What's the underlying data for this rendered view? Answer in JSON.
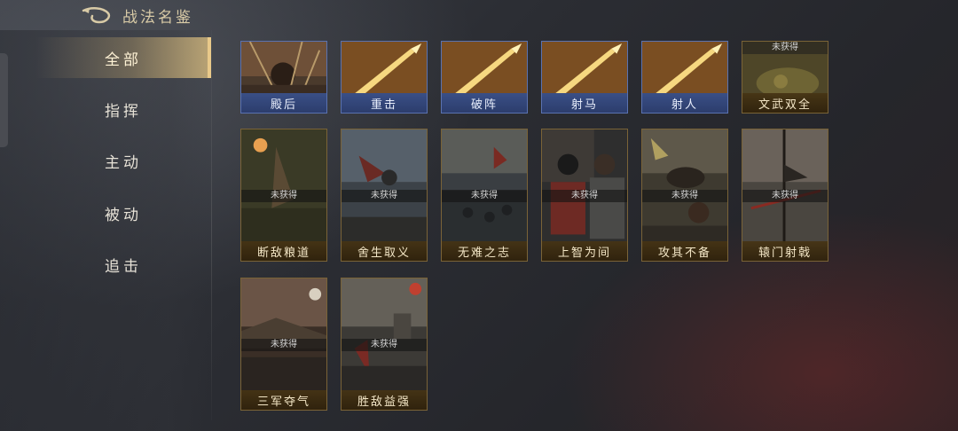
{
  "header": {
    "title": "战法名鉴",
    "back_icon": "back-arrow-icon"
  },
  "sidebar": {
    "tabs": [
      {
        "label": "全部",
        "active": true
      },
      {
        "label": "指挥",
        "active": false
      },
      {
        "label": "主动",
        "active": false
      },
      {
        "label": "被动",
        "active": false
      },
      {
        "label": "追击",
        "active": false
      }
    ]
  },
  "cards": [
    {
      "name": "殿后",
      "obtained": true,
      "style": "blue"
    },
    {
      "name": "重击",
      "obtained": true,
      "style": "blue"
    },
    {
      "name": "破阵",
      "obtained": true,
      "style": "blue"
    },
    {
      "name": "射马",
      "obtained": true,
      "style": "blue"
    },
    {
      "name": "射人",
      "obtained": true,
      "style": "blue"
    },
    {
      "name": "文武双全",
      "obtained": false,
      "style": "gold"
    },
    {
      "name": "断敌粮道",
      "obtained": false,
      "style": "gold"
    },
    {
      "name": "舍生取义",
      "obtained": false,
      "style": "gold"
    },
    {
      "name": "无难之志",
      "obtained": false,
      "style": "gold"
    },
    {
      "name": "上智为间",
      "obtained": false,
      "style": "gold"
    },
    {
      "name": "攻其不备",
      "obtained": false,
      "style": "gold"
    },
    {
      "name": "辕门射戟",
      "obtained": false,
      "style": "gold"
    },
    {
      "name": "三军夺气",
      "obtained": false,
      "style": "gold"
    },
    {
      "name": "胜敌益强",
      "obtained": false,
      "style": "gold"
    }
  ],
  "unobtained_label": "未获得",
  "colors": {
    "accent_gold": "#e9c98a",
    "blue_frame": "#5a72b0",
    "gold_frame": "#7a6337"
  }
}
